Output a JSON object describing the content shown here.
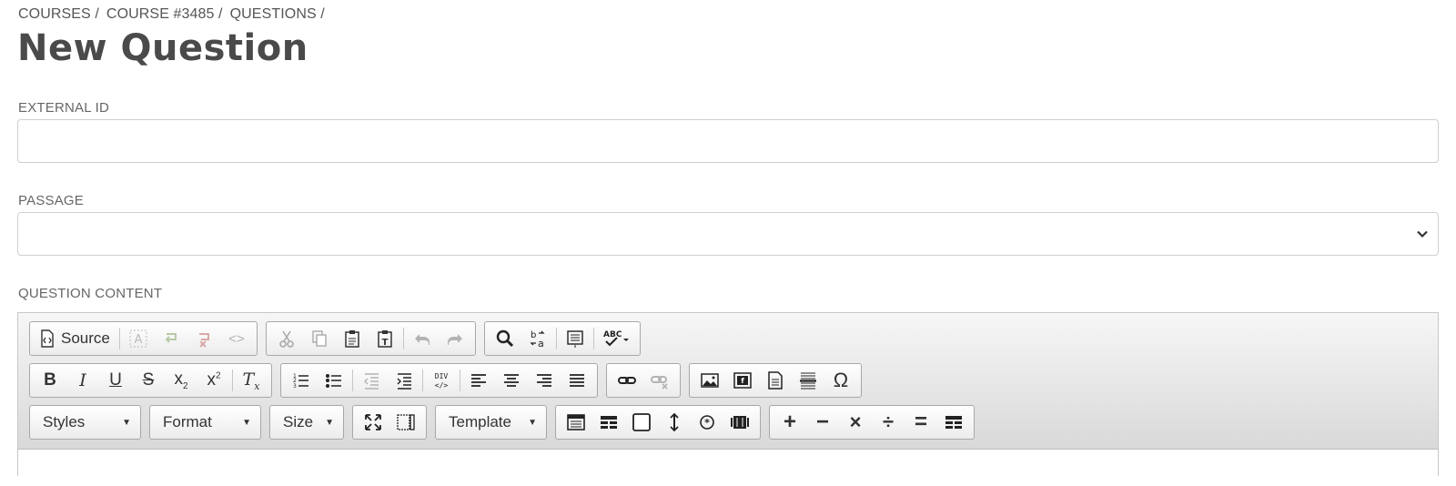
{
  "breadcrumb": [
    "COURSES /",
    "COURSE #3485 /",
    "QUESTIONS /"
  ],
  "title": "New Question",
  "external_id": {
    "label": "EXTERNAL ID",
    "value": ""
  },
  "passage": {
    "label": "PASSAGE",
    "selected": ""
  },
  "question_content": {
    "label": "QUESTION CONTENT"
  },
  "toolbar": {
    "source_label": "Source",
    "spellcheck": "ABC",
    "styles_label": "Styles",
    "format_label": "Format",
    "size_label": "Size",
    "template_label": "Template",
    "div_label": "DIV",
    "omega": "Ω",
    "plus": "+",
    "minus": "−",
    "times": "×",
    "divide": "÷",
    "equals": "="
  }
}
